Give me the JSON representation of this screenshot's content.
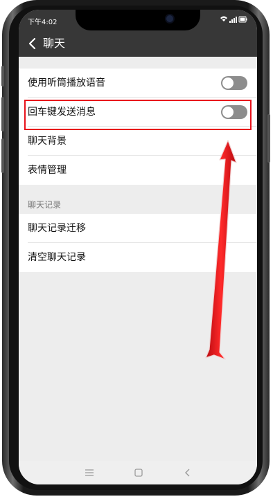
{
  "status_bar": {
    "time": "下午4:02"
  },
  "nav": {
    "title": "聊天"
  },
  "settings": [
    {
      "label": "使用听筒播放语音",
      "toggle": false
    },
    {
      "label": "回车键发送消息",
      "toggle": false
    },
    {
      "label": "聊天背景"
    },
    {
      "label": "表情管理"
    }
  ],
  "history_section": {
    "title": "聊天记录",
    "items": [
      {
        "label": "聊天记录迁移"
      },
      {
        "label": "清空聊天记录"
      }
    ]
  },
  "annotation": {
    "highlight_color": "#e8121b",
    "arrow_color": "#e8121b"
  },
  "system_nav": {
    "icons": [
      "menu-icon",
      "home-icon",
      "back-icon"
    ]
  }
}
